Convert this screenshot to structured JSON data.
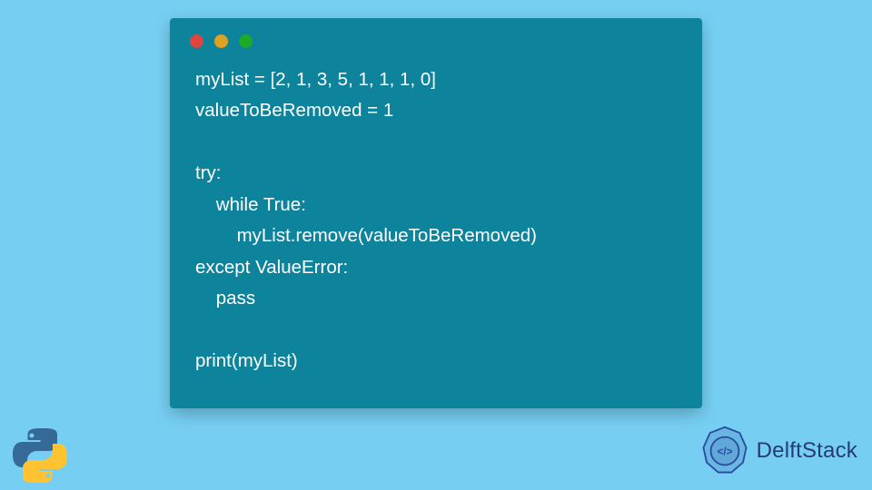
{
  "code": {
    "lines": [
      "myList = [2, 1, 3, 5, 1, 1, 1, 0]",
      "valueToBeRemoved = 1",
      "",
      "try:",
      "    while True:",
      "        myList.remove(valueToBeRemoved)",
      "except ValueError:",
      "    pass",
      "",
      "print(myList)"
    ]
  },
  "branding": {
    "name": "DelftStack"
  },
  "colors": {
    "page_bg": "#76cff2",
    "window_bg": "#0d839c",
    "code_fg": "#ffffff",
    "brand_fg": "#253a7a"
  }
}
